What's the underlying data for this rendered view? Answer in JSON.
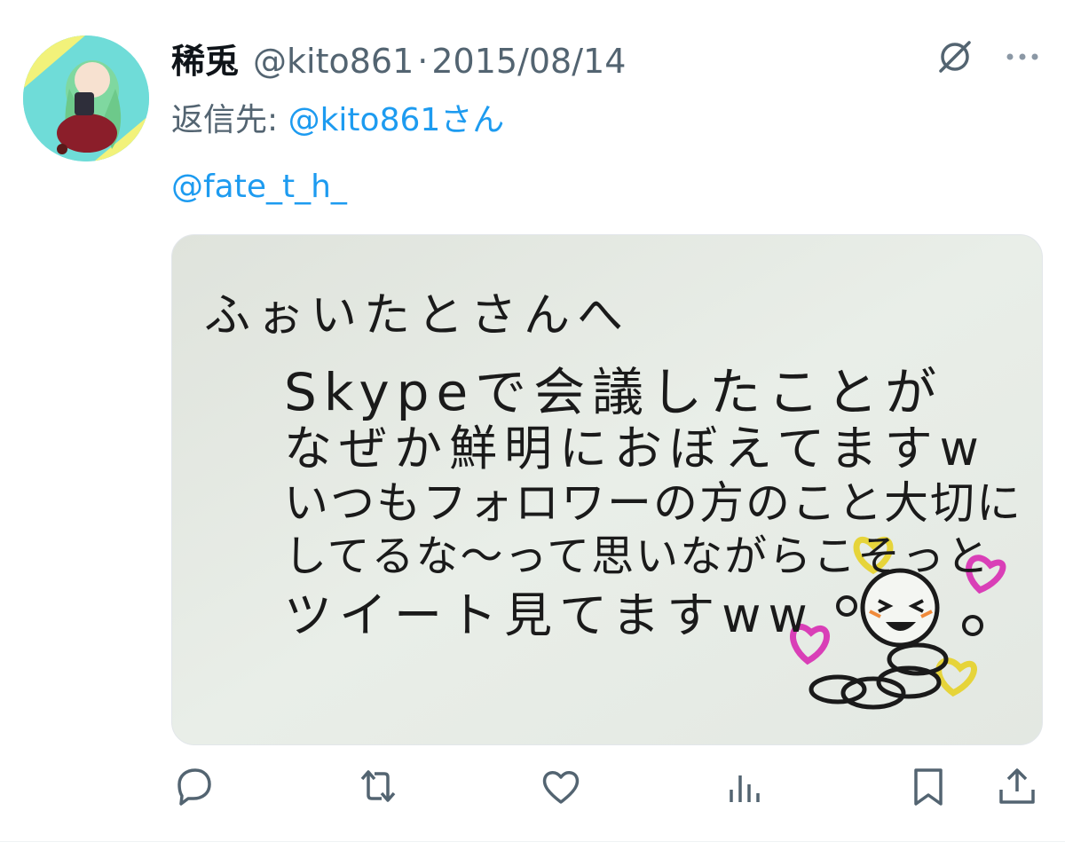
{
  "tweet": {
    "display_name": "稀兎",
    "handle": "@kito861",
    "separator": "·",
    "date": "2015/08/14",
    "reply_prefix": "返信先: ",
    "reply_to": "@kito861さん",
    "mention": "@fate_t_h_"
  },
  "media": {
    "handwritten_lines": [
      "ふぉいたとさんへ",
      "Skypeで会議したことが",
      "なぜか鮮明におぼえてますw",
      "いつもフォロワーの方のこと大切に",
      "してるな～って思いながらこそっと",
      "ツイート見てますww"
    ]
  },
  "icons": {
    "top": [
      "no-translate-icon",
      "more-icon"
    ],
    "actions": [
      "reply-icon",
      "retweet-icon",
      "like-icon",
      "views-icon",
      "bookmark-icon",
      "share-icon"
    ]
  },
  "colors": {
    "link": "#1d9bf0",
    "secondary_text": "#536471",
    "primary_text": "#0f1419",
    "heart_yellow": "#e6d43a",
    "heart_pink": "#d93fb7"
  }
}
